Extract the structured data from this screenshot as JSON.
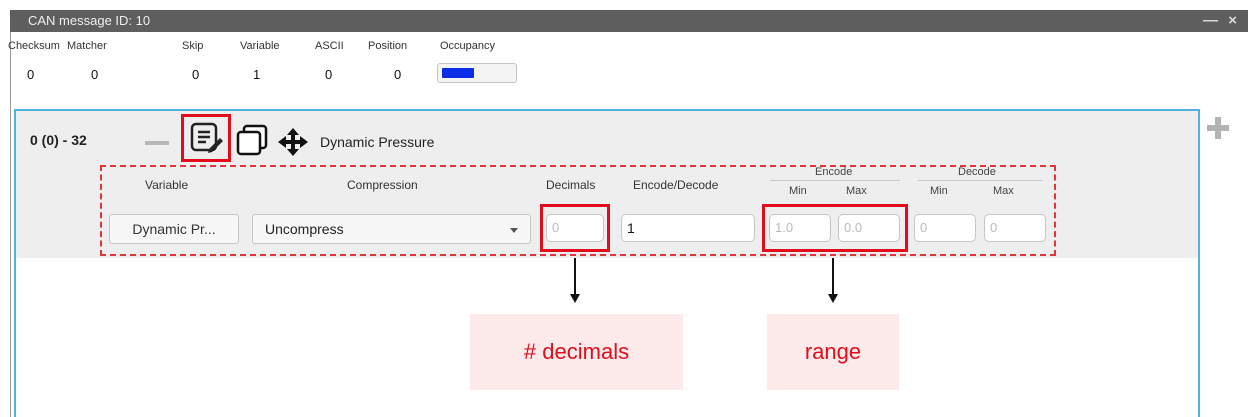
{
  "window": {
    "title": "CAN message ID: 10",
    "controls": "— ×"
  },
  "stats": {
    "labels": [
      "Checksum",
      "Matcher",
      "Skip",
      "Variable",
      "ASCII",
      "Position",
      "Occupancy"
    ],
    "values": [
      "0",
      "0",
      "0",
      "1",
      "0",
      "0"
    ],
    "occupancy_fill": 0.45
  },
  "row": {
    "id_text": "0 (0) - 32",
    "field_name": "Dynamic Pressure"
  },
  "columns": {
    "variable": "Variable",
    "compression": "Compression",
    "decimals": "Decimals",
    "encode_decode": "Encode/Decode",
    "encode": "Encode",
    "decode": "Decode",
    "min": "Min",
    "max": "Max"
  },
  "fields": {
    "variable_button": "Dynamic Pr...",
    "compression_value": "Uncompress",
    "decimals_placeholder": "0",
    "encode_decode_value": "1",
    "encode_min_placeholder": "1.0",
    "encode_max_placeholder": "0.0",
    "decode_min_placeholder": "0",
    "decode_max_placeholder": "0"
  },
  "annotations": {
    "decimals": "# decimals",
    "range": "range"
  },
  "colors": {
    "highlight": "#e20d1a",
    "occupancy": "#0a2ee6",
    "panel_border": "#4fb3de"
  }
}
